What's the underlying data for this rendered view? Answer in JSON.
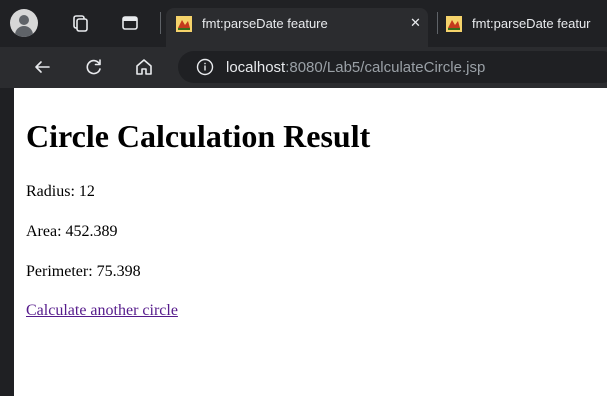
{
  "browser": {
    "tabs": [
      {
        "title": "fmt:parseDate feature",
        "active": true
      },
      {
        "title": "fmt:parseDate featur",
        "active": false
      }
    ],
    "url": {
      "host": "localhost",
      "rest": ":8080/Lab5/calculateCircle.jsp"
    }
  },
  "page": {
    "heading": "Circle Calculation Result",
    "results": [
      {
        "label": "Radius:",
        "value": "12"
      },
      {
        "label": "Area:",
        "value": "452.389"
      },
      {
        "label": "Perimeter:",
        "value": "75.398"
      }
    ],
    "link_text": "Calculate another circle"
  },
  "colors": {
    "chrome_dark": "#202124",
    "toolbar": "#2b2c2f",
    "link_visited": "#551a8b"
  }
}
